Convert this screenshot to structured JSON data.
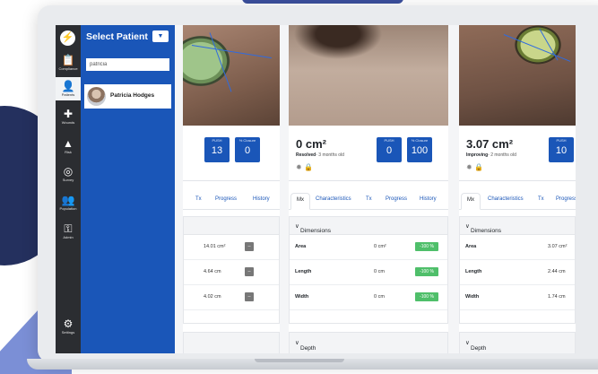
{
  "nav": {
    "items": [
      {
        "label": "Compliance",
        "icon": "clipboard-icon"
      },
      {
        "label": "Patients",
        "icon": "person-icon"
      },
      {
        "label": "Wounds",
        "icon": "bandage-icon"
      },
      {
        "label": "Risk",
        "icon": "warning-icon"
      },
      {
        "label": "Survey",
        "icon": "survey-icon"
      },
      {
        "label": "Population",
        "icon": "population-icon"
      },
      {
        "label": "Admin",
        "icon": "key-icon"
      }
    ],
    "settings": {
      "label": "Settings",
      "icon": "gear-icon"
    }
  },
  "patient_panel": {
    "title": "Select Patient",
    "dropdown_glyph": "▼",
    "search_value": "patricia",
    "results": [
      {
        "name": "Patricia Hodges"
      }
    ]
  },
  "tabs": [
    "Mx",
    "Characteristics",
    "Tx",
    "Progress",
    "History"
  ],
  "wounds": [
    {
      "push_label": "PUSH",
      "push": "13",
      "closure_label": "% Closure",
      "closure": "0",
      "tabs_visible": [
        "Tx",
        "Progress",
        "History"
      ],
      "section_title": "",
      "rows": [
        {
          "label": "",
          "value": "14.01 cm²",
          "change": "--"
        },
        {
          "label": "",
          "value": "4.64 cm",
          "change": "--"
        },
        {
          "label": "",
          "value": "4.02 cm",
          "change": "--"
        }
      ]
    },
    {
      "area": "0 cm²",
      "status": "Resolved",
      "age": "- 3 months old",
      "push_label": "PUSH",
      "push": "0",
      "closure_label": "% Closure",
      "closure": "100",
      "section_title": "Dimensions",
      "rows": [
        {
          "label": "Area",
          "value": "0 cm²",
          "change": "-100 %"
        },
        {
          "label": "Length",
          "value": "0 cm",
          "change": "-100 %"
        },
        {
          "label": "Width",
          "value": "0 cm",
          "change": "-100 %"
        }
      ],
      "section2_title": "Depth"
    },
    {
      "area": "3.07 cm²",
      "status": "Improving",
      "age": "- 2 months old",
      "push_label": "PUSH",
      "push": "10",
      "section_title": "Dimensions",
      "rows": [
        {
          "label": "Area",
          "value": "3.07 cm²"
        },
        {
          "label": "Length",
          "value": "2.44 cm"
        },
        {
          "label": "Width",
          "value": "1.74 cm"
        }
      ],
      "section2_title": "Depth"
    }
  ],
  "colors": {
    "brand_blue": "#1a56b8",
    "rail": "#2b2d31",
    "positive": "#4fbf6a"
  }
}
